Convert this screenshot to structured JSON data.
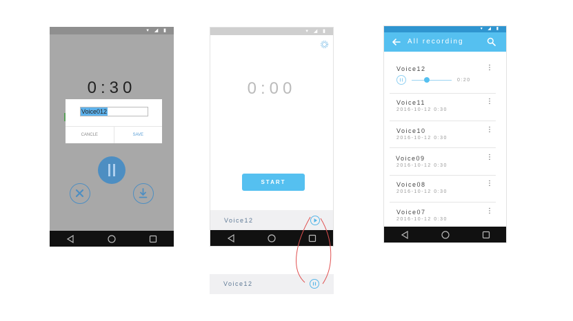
{
  "screen1": {
    "timer": "0:30",
    "dialog": {
      "input_value": "Voice012",
      "cancel_label": "CANCLE",
      "save_label": "SAVE"
    }
  },
  "screen2": {
    "timer": "0:00",
    "start_label": "START",
    "playing_item": "Voice12",
    "paused_item": "Voice12"
  },
  "screen3": {
    "title": "All recording",
    "recordings": [
      {
        "name": "Voice12",
        "date": "",
        "time": "0:20",
        "progress": 0.35
      },
      {
        "name": "Voice11",
        "date": "2016-10-12  0:30"
      },
      {
        "name": "Voice10",
        "date": "2016-10-12  0:30"
      },
      {
        "name": "Voice09",
        "date": "2016-10-12  0:30"
      },
      {
        "name": "Voice08",
        "date": "2016-10-12  0:30"
      },
      {
        "name": "Voice07",
        "date": "2016-10-12  0:30"
      }
    ]
  },
  "icons": {
    "status": [
      "wifi-icon",
      "signal-icon",
      "battery-icon"
    ],
    "nav": [
      "back-icon",
      "home-icon",
      "recents-icon"
    ]
  },
  "colors": {
    "accent": "#55c0f0",
    "dark_accent": "#4d8ec2",
    "annotation": "#e05050"
  }
}
